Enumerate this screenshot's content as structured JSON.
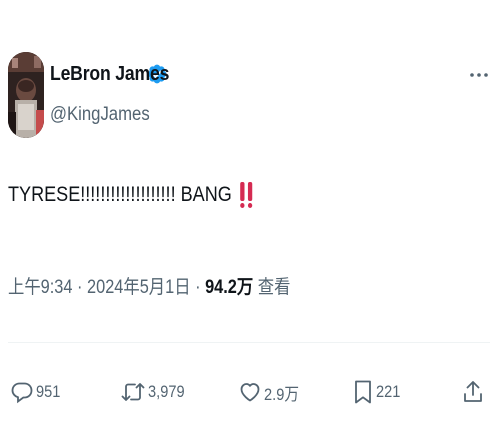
{
  "author": {
    "display_name": "LeBron James",
    "handle": "@KingJames",
    "verified": true
  },
  "tweet": {
    "text": "TYRESE!!!!!!!!!!!!!!!!!!! BANG",
    "emoji": "double-exclamation-emoji"
  },
  "meta": {
    "time": "上午9:34",
    "sep1": " · ",
    "date": "2024年5月1日",
    "sep2": " · ",
    "views_count": "94.2万",
    "views_label": " 查看"
  },
  "actions": {
    "replies": "951",
    "reposts": "3,979",
    "likes": "2.9万",
    "bookmarks": "221"
  },
  "colors": {
    "verified": "#1d9bf0",
    "text": "#0f1419",
    "secondary": "#536471",
    "emoji_red": "#d52b52"
  }
}
